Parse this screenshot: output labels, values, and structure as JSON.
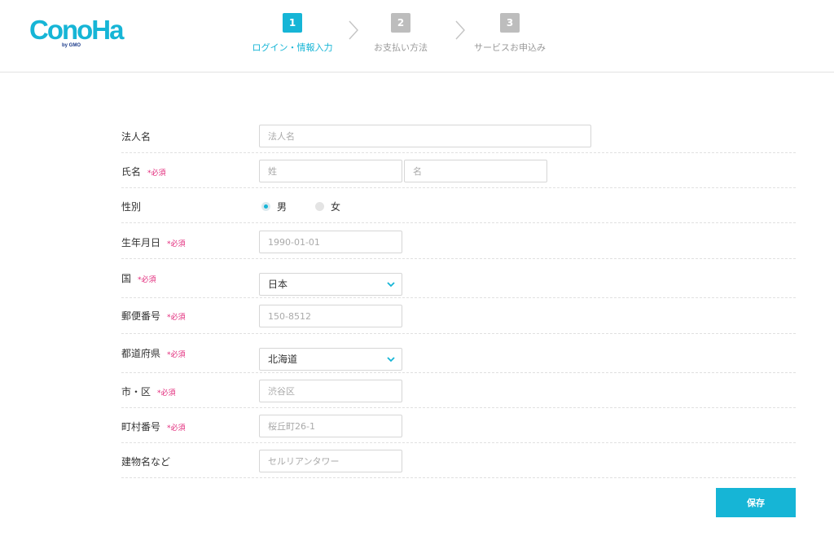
{
  "brand": {
    "logo_text": "ConoHa",
    "logo_sub": "by GMO",
    "color": "#16b5d6"
  },
  "steps": [
    {
      "num": "1",
      "label": "ログイン・情報入力",
      "active": true
    },
    {
      "num": "2",
      "label": "お支払い方法",
      "active": false
    },
    {
      "num": "3",
      "label": "サービスお申込み",
      "active": false
    }
  ],
  "required_mark": "*必須",
  "form": {
    "company": {
      "label": "法人名",
      "placeholder": "法人名"
    },
    "name": {
      "label": "氏名",
      "last_placeholder": "姓",
      "first_placeholder": "名"
    },
    "gender": {
      "label": "性別",
      "options": [
        "男",
        "女"
      ],
      "selected": "男"
    },
    "birthdate": {
      "label": "生年月日",
      "placeholder": "1990-01-01"
    },
    "country": {
      "label": "国",
      "value": "日本"
    },
    "postal": {
      "label": "郵便番号",
      "placeholder": "150-8512"
    },
    "prefecture": {
      "label": "都道府県",
      "value": "北海道"
    },
    "city": {
      "label": "市・区",
      "placeholder": "渋谷区"
    },
    "town": {
      "label": "町村番号",
      "placeholder": "桜丘町26-1"
    },
    "building": {
      "label": "建物名など",
      "placeholder": "セルリアンタワー"
    }
  },
  "save_label": "保存"
}
